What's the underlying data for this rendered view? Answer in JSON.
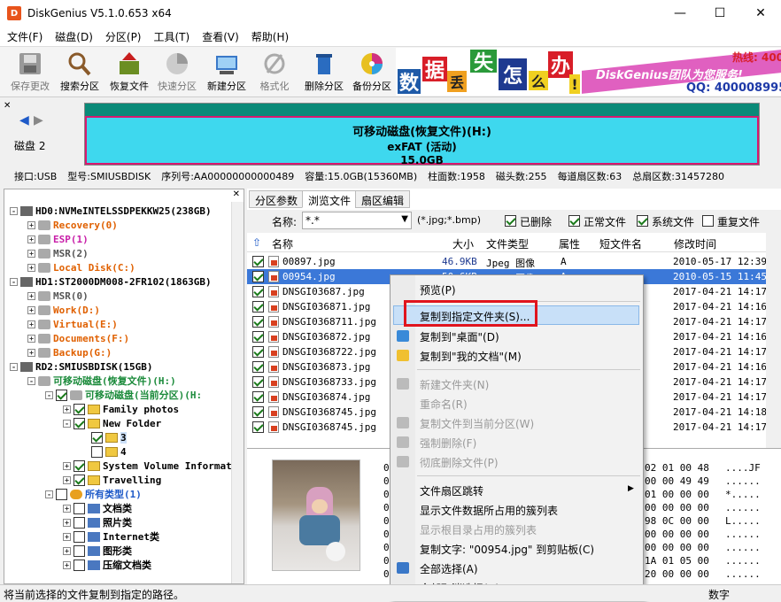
{
  "window": {
    "title": "DiskGenius V5.1.0.653 x64",
    "icon_letter": "D"
  },
  "menubar": [
    "文件(F)",
    "磁盘(D)",
    "分区(P)",
    "工具(T)",
    "查看(V)",
    "帮助(H)"
  ],
  "toolbar": [
    "保存更改",
    "搜索分区",
    "恢复文件",
    "快速分区",
    "新建分区",
    "格式化",
    "删除分区",
    "备份分区"
  ],
  "banner": {
    "chars": [
      "数",
      "据",
      "丢",
      "失",
      "怎",
      "么",
      "办",
      "!"
    ],
    "slogan": "DiskGenius团队为您服务!",
    "qq": "QQ: 4000089958",
    "hotline": "热线: 400-"
  },
  "disk_nav": {
    "label": "磁盘 2"
  },
  "partition": {
    "name": "可移动磁盘(恢复文件)(H:)",
    "fs": "exFAT (活动)",
    "size": "15.0GB"
  },
  "info_bar": [
    "接口:USB",
    "型号:SMIUSBDISK",
    "序列号:AA00000000000489",
    "容量:15.0GB(15360MB)",
    "柱面数:1958",
    "磁头数:255",
    "每道扇区数:63",
    "总扇区数:31457280"
  ],
  "tree": [
    "HD0:NVMeINTELSSDPEKKW25(238GB)",
    "Recovery(0)",
    "ESP(1)",
    "MSR(2)",
    "Local Disk(C:)",
    "HD1:ST2000DM008-2FR102(1863GB)",
    "MSR(0)",
    "Work(D:)",
    "Virtual(E:)",
    "Documents(F:)",
    "Backup(G:)",
    "RD2:SMIUSBDISK(15GB)",
    "可移动磁盘(恢复文件)(H:)",
    "可移动磁盘(当前分区)(H:",
    "Family photos",
    "New Folder",
    "3",
    "4",
    "System Volume Informat",
    "Travelling",
    "所有类型(1)",
    "文档类",
    "照片类",
    "Internet类",
    "图形类",
    "压缩文档类"
  ],
  "tabs": [
    "分区参数",
    "浏览文件",
    "扇区编辑"
  ],
  "filter": {
    "name_label": "名称:",
    "name_value": "*.*",
    "ext_hint": "(*.jpg;*.bmp)",
    "checks": [
      "已删除",
      "正常文件",
      "系统文件",
      "重复文件"
    ]
  },
  "columns": [
    "名称",
    "大小",
    "文件类型",
    "属性",
    "短文件名",
    "修改时间"
  ],
  "files": [
    {
      "name": "00897.jpg",
      "size": "46.9KB",
      "type": "Jpeg 图像",
      "attr": "A",
      "time": "2010-05-17 12:39:"
    },
    {
      "name": "00954.jpg",
      "size": "50.6KB",
      "type": "Jpeg 图像",
      "attr": "A",
      "time": "2010-05-15 11:45:"
    },
    {
      "name": "DNSGI03687.jpg",
      "time": "2017-04-21 14:17:"
    },
    {
      "name": "DNSGI036871.jpg",
      "time": "2017-04-21 14:16:"
    },
    {
      "name": "DNSGI0368711.jpg",
      "time": "2017-04-21 14:17:"
    },
    {
      "name": "DNSGI036872.jpg",
      "time": "2017-04-21 14:16:"
    },
    {
      "name": "DNSGI0368722.jpg",
      "time": "2017-04-21 14:17:"
    },
    {
      "name": "DNSGI036873.jpg",
      "time": "2017-04-21 14:16:"
    },
    {
      "name": "DNSGI0368733.jpg",
      "time": "2017-04-21 14:17:"
    },
    {
      "name": "DNSGI036874.jpg",
      "time": "2017-04-21 14:17:"
    },
    {
      "name": "DNSGI0368745.jpg",
      "time": "2017-04-21 14:18:"
    },
    {
      "name": "DNSGI0368745.jpg",
      "time": "2017-04-21 14:17:"
    }
  ],
  "hex_left": [
    "0",
    "0",
    "0",
    "0",
    "0",
    "0",
    "0",
    "0",
    "0"
  ],
  "hex_right": [
    "02 01 00 48",
    "00 00 49 49",
    "01 00 00 00",
    "00 00 00 00",
    "98 0C 00 00",
    "00 00 00 00",
    "00 00 00 00",
    "1A 01 05 00",
    "20 00 00 00"
  ],
  "ascii": [
    "....JF",
    "......",
    "*.....",
    "......",
    "L.....",
    "......",
    "......",
    "......",
    "......"
  ],
  "context_menu": [
    {
      "label": "预览(P)",
      "disabled": false
    },
    {
      "label": "复制到指定文件夹(S)...",
      "disabled": false,
      "highlight": true
    },
    {
      "label": "复制到\"桌面\"(D)",
      "disabled": false
    },
    {
      "label": "复制到\"我的文档\"(M)",
      "disabled": false
    },
    {
      "label": "新建文件夹(N)",
      "disabled": true
    },
    {
      "label": "重命名(R)",
      "disabled": true
    },
    {
      "label": "复制文件到当前分区(W)",
      "disabled": true
    },
    {
      "label": "强制删除(F)",
      "disabled": true
    },
    {
      "label": "彻底删除文件(P)",
      "disabled": true
    },
    {
      "label": "文件扇区跳转",
      "disabled": false,
      "submenu": true
    },
    {
      "label": "显示文件数据所占用的簇列表",
      "disabled": false
    },
    {
      "label": "显示根目录占用的簇列表",
      "disabled": true
    },
    {
      "label": "复制文字: \"00954.jpg\" 到剪贴板(C)",
      "disabled": false
    },
    {
      "label": "全部选择(A)",
      "disabled": false
    },
    {
      "label": "全部取消选择(U)",
      "disabled": false
    }
  ],
  "status": {
    "text": "将当前选择的文件复制到指定的路径。",
    "mode": "数字"
  },
  "colors": {
    "partition_fill": "#3ed8ee",
    "partition_border": "#d8186e",
    "highlight_box": "#e0141e",
    "selection": "#3b78d8"
  }
}
